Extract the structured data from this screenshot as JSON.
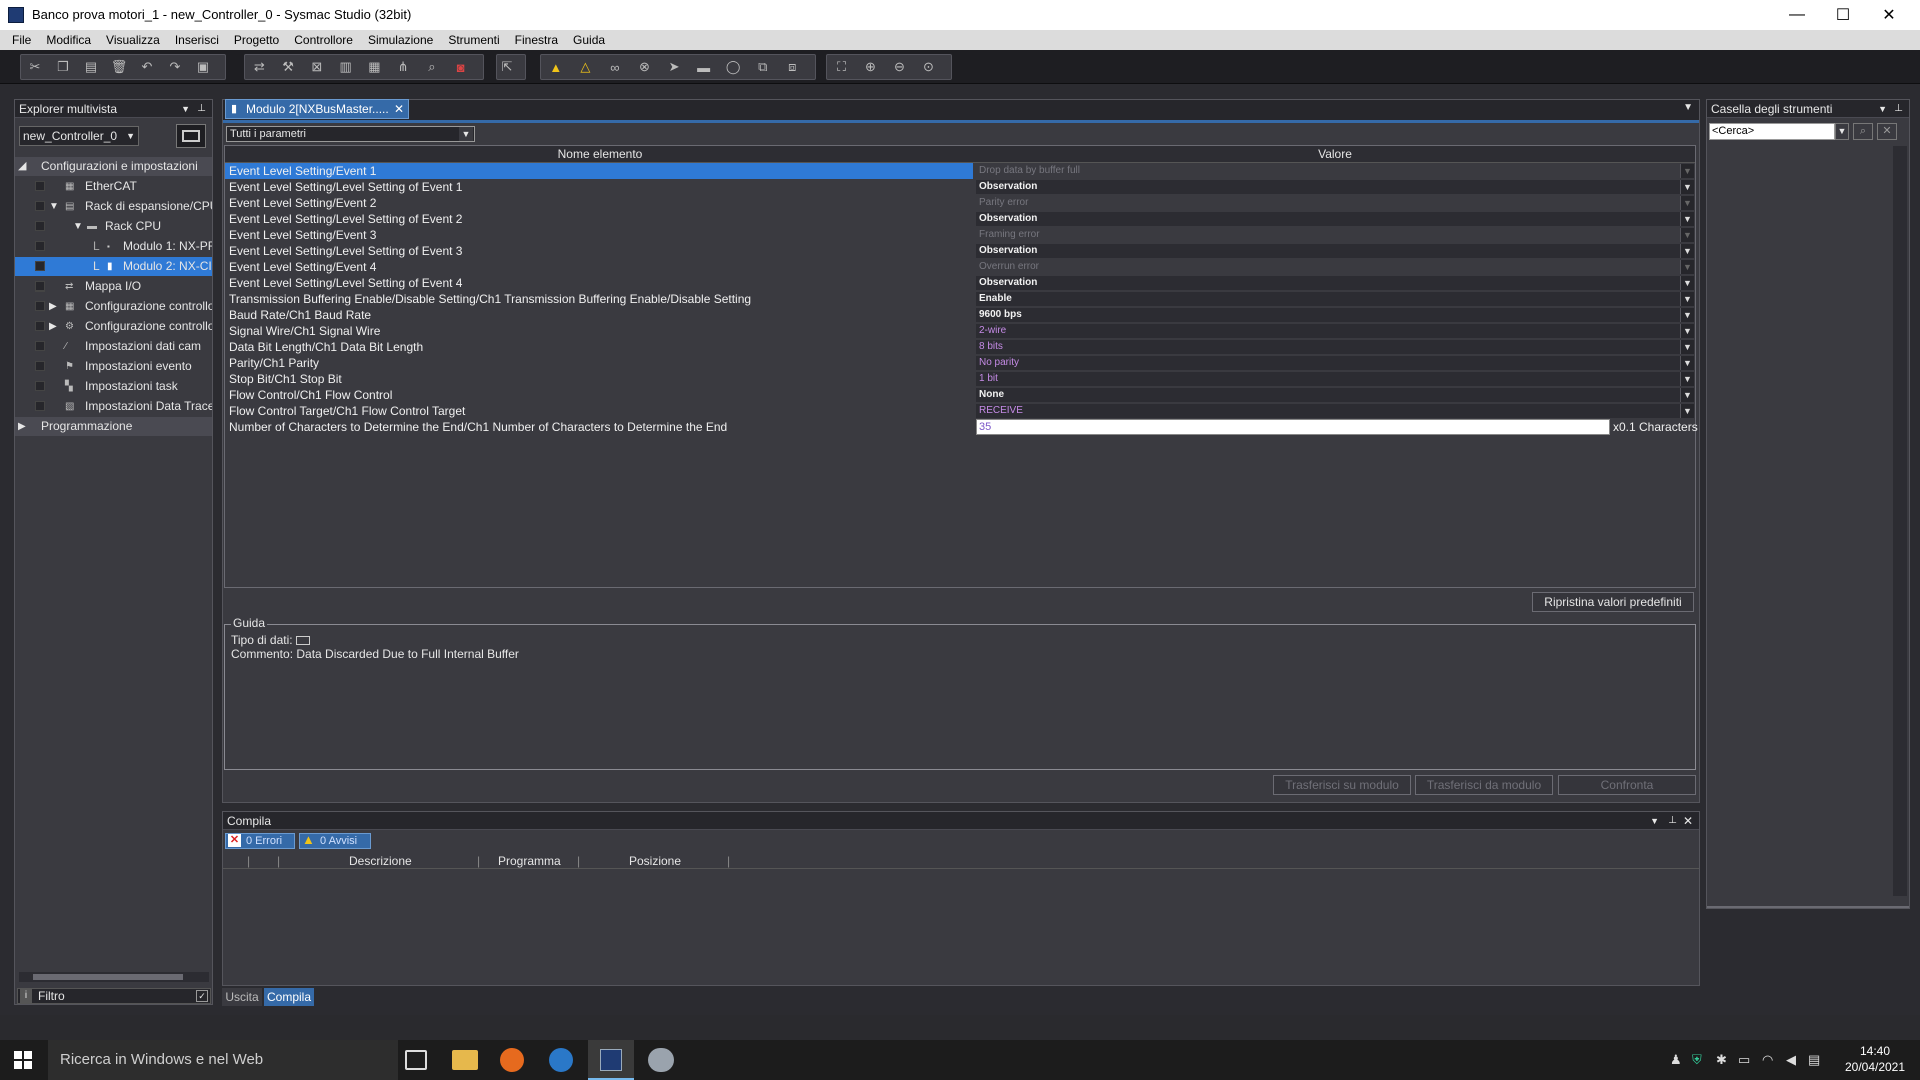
{
  "window": {
    "title": "Banco prova motori_1 - new_Controller_0 - Sysmac Studio (32bit)",
    "controls": {
      "minimize": "—",
      "maximize": "☐",
      "close": "✕"
    }
  },
  "menu": [
    "File",
    "Modifica",
    "Visualizza",
    "Inserisci",
    "Progetto",
    "Controllore",
    "Simulazione",
    "Strumenti",
    "Finestra",
    "Guida"
  ],
  "toolbar": {
    "icons": [
      "cut-icon",
      "copy-icon",
      "paste-icon",
      "delete-icon",
      "undo-icon",
      "redo-icon",
      "build-icon",
      "transfer-icon",
      "tool-icon",
      "cross-ref-icon",
      "io-icon",
      "table-icon",
      "tree-icon",
      "search-icon",
      "stop-icon",
      "online-icon",
      "warning-icon",
      "warning2-icon",
      "glasses-icon",
      "monitor-icon",
      "step-icon",
      "pause-icon",
      "refresh-icon",
      "window-icon",
      "compare-icon",
      "fit-icon",
      "zoom-in-icon",
      "zoom-out-icon",
      "zoom-reset-icon"
    ]
  },
  "explorer": {
    "title": "Explorer multivista",
    "controller": "new_Controller_0",
    "tree": [
      {
        "label": "Configurazioni e impostazioni",
        "indent": 0,
        "expanded": true
      },
      {
        "label": "EtherCAT",
        "indent": 1
      },
      {
        "label": "Rack di espansione/CPU",
        "indent": 1,
        "expanded": true
      },
      {
        "label": "Rack CPU",
        "indent": 2,
        "expanded": true
      },
      {
        "label": "Modulo 1: NX-PF",
        "indent": 3
      },
      {
        "label": "Modulo 2: NX-CI",
        "indent": 3,
        "selected": true
      },
      {
        "label": "Mappa I/O",
        "indent": 1
      },
      {
        "label": "Configurazione controllo",
        "indent": 1,
        "collapsed": true
      },
      {
        "label": "Configurazione controllo",
        "indent": 1,
        "collapsed": true
      },
      {
        "label": "Impostazioni dati cam",
        "indent": 1
      },
      {
        "label": "Impostazioni evento",
        "indent": 1
      },
      {
        "label": "Impostazioni task",
        "indent": 1
      },
      {
        "label": "Impostazioni Data Trace",
        "indent": 1
      },
      {
        "label": "Programmazione",
        "indent": 0,
        "collapsed": true
      }
    ],
    "filter_label": "Filtro"
  },
  "editor": {
    "tab_label": "Modulo 2[NXBusMaster.....",
    "filter_select": "Tutti i parametri",
    "columns": {
      "name": "Nome elemento",
      "value": "Valore"
    },
    "rows": [
      {
        "name": "Event Level Setting/Event 1",
        "value": "Drop data by buffer full",
        "style": "dis",
        "selected": true
      },
      {
        "name": "Event Level Setting/Level Setting of Event 1",
        "value": "Observation",
        "style": "bold"
      },
      {
        "name": "Event Level Setting/Event 2",
        "value": "Parity error",
        "style": "dis"
      },
      {
        "name": "Event Level Setting/Level Setting of Event 2",
        "value": "Observation",
        "style": "bold"
      },
      {
        "name": "Event Level Setting/Event 3",
        "value": "Framing error",
        "style": "dis"
      },
      {
        "name": "Event Level Setting/Level Setting of Event 3",
        "value": "Observation",
        "style": "bold"
      },
      {
        "name": "Event Level Setting/Event 4",
        "value": "Overrun error",
        "style": "dis"
      },
      {
        "name": "Event Level Setting/Level Setting of Event 4",
        "value": "Observation",
        "style": "bold"
      },
      {
        "name": "Transmission Buffering Enable/Disable Setting/Ch1 Transmission Buffering Enable/Disable Setting",
        "value": "Enable",
        "style": "bold"
      },
      {
        "name": "Baud Rate/Ch1 Baud Rate",
        "value": "9600 bps",
        "style": "bold"
      },
      {
        "name": "Signal Wire/Ch1 Signal Wire",
        "value": "2-wire",
        "style": "pur"
      },
      {
        "name": "Data Bit Length/Ch1 Data Bit Length",
        "value": "8 bits",
        "style": "pur"
      },
      {
        "name": "Parity/Ch1 Parity",
        "value": "No parity",
        "style": "pur"
      },
      {
        "name": "Stop Bit/Ch1 Stop Bit",
        "value": "1 bit",
        "style": "pur"
      },
      {
        "name": "Flow Control/Ch1 Flow Control",
        "value": "None",
        "style": "bold"
      },
      {
        "name": "Flow Control Target/Ch1 Flow Control Target",
        "value": "RECEIVE",
        "style": "pur"
      }
    ],
    "last_row": {
      "name": "Number of Characters to Determine the End/Ch1 Number of Characters to Determine the End",
      "value": "35",
      "unit": "x0.1 Characters"
    },
    "reset_button": "Ripristina valori predefiniti",
    "guida": {
      "legend": "Guida",
      "data_type_label": "Tipo di dati:",
      "comment": "Commento: Data Discarded Due to Full Internal Buffer"
    },
    "buttons": {
      "transfer_to": "Trasferisci su modulo",
      "transfer_from": "Trasferisci da modulo",
      "compare": "Confronta"
    }
  },
  "compila": {
    "title": "Compila",
    "errors": "0  Errori",
    "warnings": "0  Avvisi",
    "columns": [
      "Descrizione",
      "Programma",
      "Posizione"
    ],
    "bottom_tabs": [
      "Uscita",
      "Compila"
    ]
  },
  "toolbox": {
    "title": "Casella degli strumenti",
    "search_placeholder": "<Cerca>"
  },
  "taskbar": {
    "search_text": "Ricerca in Windows e nel Web",
    "time": "14:40",
    "date": "20/04/2021"
  },
  "colors": {
    "selection": "#2f7ad6",
    "panel": "#3a3a40",
    "accent_tab": "#356aa8",
    "purple_value": "#c58be6",
    "warning": "#f0c419"
  }
}
